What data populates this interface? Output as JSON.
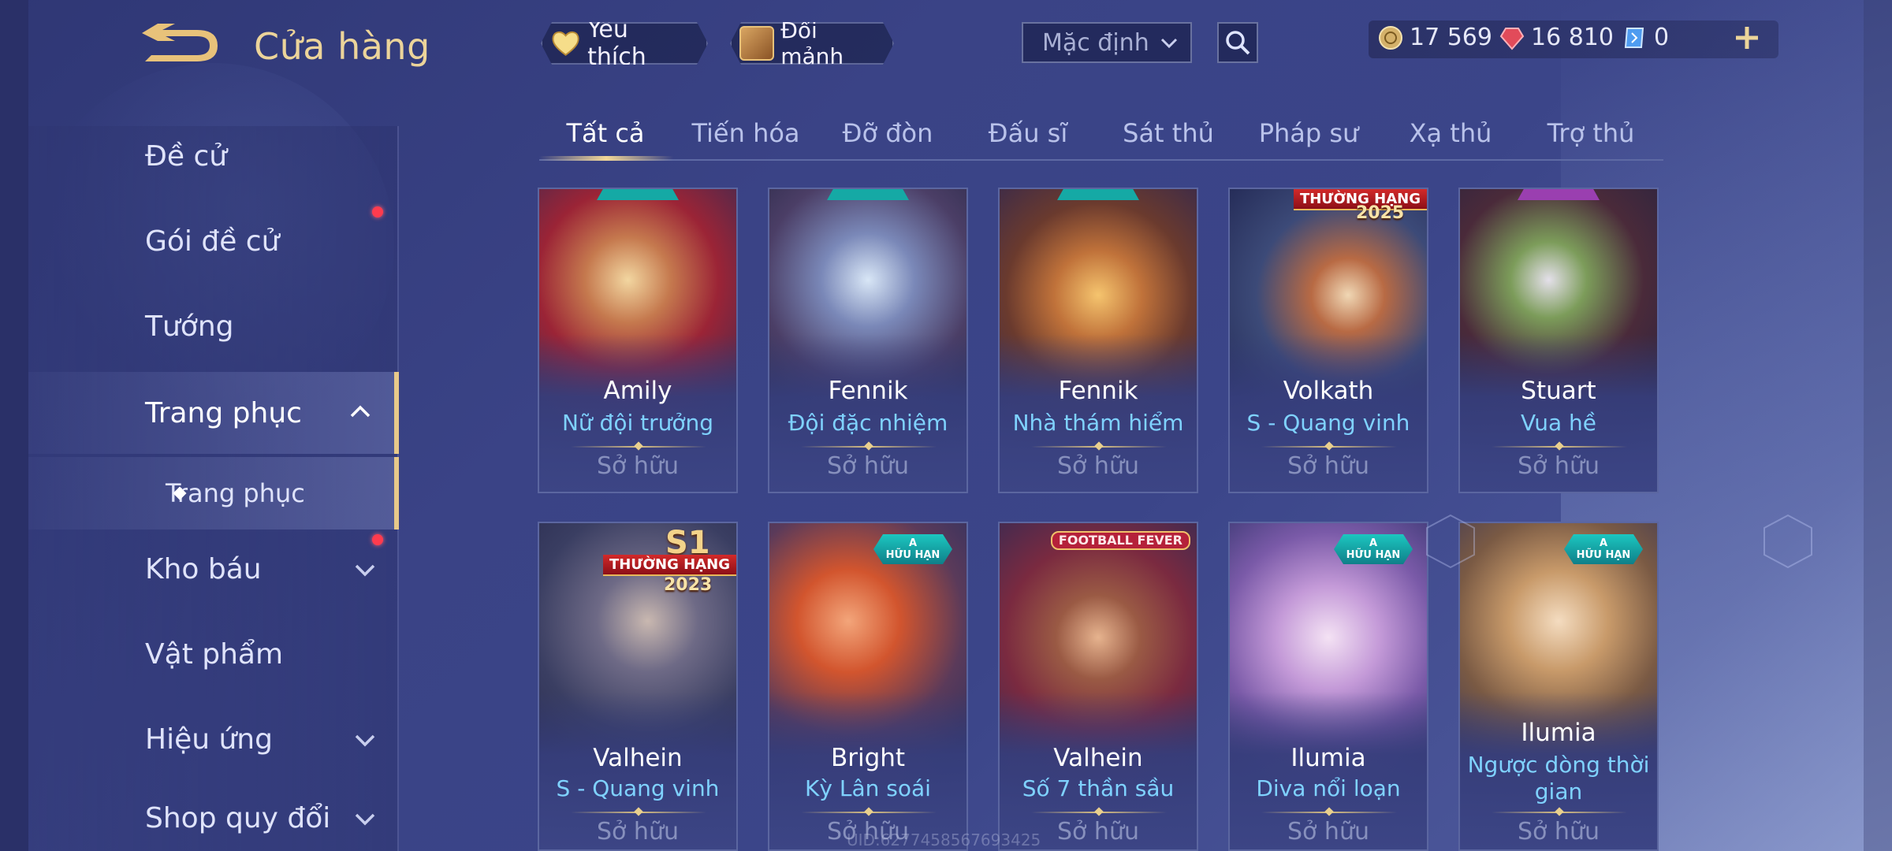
{
  "header": {
    "title": "Cửa hàng",
    "favorite_label": "Yêu thích",
    "fragment_label": "Đổi mảnh",
    "sort_value": "Mặc định"
  },
  "currency": {
    "gold": "17 569",
    "ruby": "16 810",
    "ticket": "0"
  },
  "sidebar": {
    "items": [
      {
        "label": "Đề cử"
      },
      {
        "label": "Gói đề cử"
      },
      {
        "label": "Tướng"
      },
      {
        "label": "Trang phục"
      },
      {
        "label": "Trang phục"
      },
      {
        "label": "Kho báu"
      },
      {
        "label": "Vật phẩm"
      },
      {
        "label": "Hiệu ứng"
      },
      {
        "label": "Shop quy đổi"
      }
    ]
  },
  "tabs": [
    "Tất cả",
    "Tiến hóa",
    "Đỡ đòn",
    "Đấu sĩ",
    "Sát thủ",
    "Pháp sư",
    "Xạ thủ",
    "Trợ thủ"
  ],
  "badges": {
    "rank": "THƯỜNG HẠNG",
    "year_2025": "2025",
    "year_2023": "2023",
    "s1": "S1",
    "tier_a": "A",
    "limited": "HỮU HẠN",
    "football": "FOOTBALL FEVER"
  },
  "cards": [
    {
      "hero": "Amily",
      "skin": "Nữ đội trưởng",
      "status": "Sở hữu"
    },
    {
      "hero": "Fennik",
      "skin": "Đội đặc nhiệm",
      "status": "Sở hữu"
    },
    {
      "hero": "Fennik",
      "skin": "Nhà thám hiểm",
      "status": "Sở hữu"
    },
    {
      "hero": "Volkath",
      "skin": "S - Quang vinh",
      "status": "Sở hữu"
    },
    {
      "hero": "Stuart",
      "skin": "Vua hề",
      "status": "Sở hữu"
    },
    {
      "hero": "Valhein",
      "skin": "S - Quang vinh",
      "status": "Sở hữu"
    },
    {
      "hero": "Bright",
      "skin": "Kỳ Lân soái",
      "status": "Sở hữu"
    },
    {
      "hero": "Valhein",
      "skin": "Số 7 thần sầu",
      "status": "Sở hữu"
    },
    {
      "hero": "Ilumia",
      "skin": "Diva nổi loạn",
      "status": "Sở hữu"
    },
    {
      "hero": "Ilumia",
      "skin": "Ngược dòng thời gian",
      "status": "Sở hữu"
    }
  ],
  "watermark": "UID:6277458567693425",
  "colors": {
    "accent_gold": "#e8c98a",
    "skin_blue": "#7fd2ff",
    "notify_red": "#ff3b4e"
  }
}
